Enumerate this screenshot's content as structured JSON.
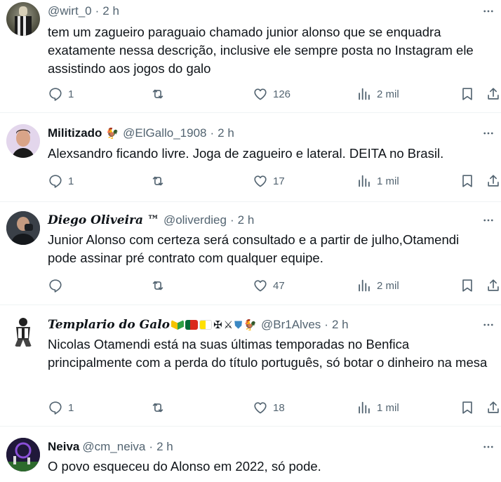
{
  "colors": {
    "text": "#0f1419",
    "muted": "#536471",
    "divider": "#eff3f4"
  },
  "posts": [
    {
      "display_name": "",
      "handle": "@wirt_0",
      "time": "2 h",
      "text": "tem um zagueiro paraguaio chamado junior alonso que se enquadra exatamente nessa descrição, inclusive ele sempre posta no Instagram ele assistindo aos jogos do galo",
      "replies": "1",
      "likes": "126",
      "views": "2 mil"
    },
    {
      "display_name": "Militizado",
      "handle": "@ElGallo_1908",
      "time": "2 h",
      "text": "Alexsandro ficando livre. Joga de zagueiro e lateral. DEITA no Brasil.",
      "replies": "1",
      "likes": "17",
      "views": "1 mil"
    },
    {
      "display_name": "Diego Oliveira ™",
      "handle": "@oliverdieg",
      "time": "2 h",
      "text": "Junior Alonso com certeza será consultado e a partir de julho,Otamendi pode assinar pré contrato com qualquer equipe.",
      "replies": "",
      "likes": "47",
      "views": "2 mil"
    },
    {
      "display_name": "Templario do Galo",
      "handle": "@Br1Alves",
      "time": "2 h",
      "text": "Nicolas Otamendi está na suas últimas temporadas no Benfica principalmente com a perda do título português, só botar o dinheiro na mesa",
      "replies": "1",
      "likes": "18",
      "views": "1 mil"
    },
    {
      "display_name": "Neiva",
      "handle": "@cm_neiva",
      "time": "2 h",
      "text": "O povo esqueceu do Alonso em 2022, só pode."
    }
  ],
  "icons": {
    "reply": "reply-icon",
    "repost": "repost-icon",
    "like": "heart-icon",
    "views": "views-icon",
    "bookmark": "bookmark-icon",
    "share": "share-icon",
    "more": "more-icon"
  }
}
